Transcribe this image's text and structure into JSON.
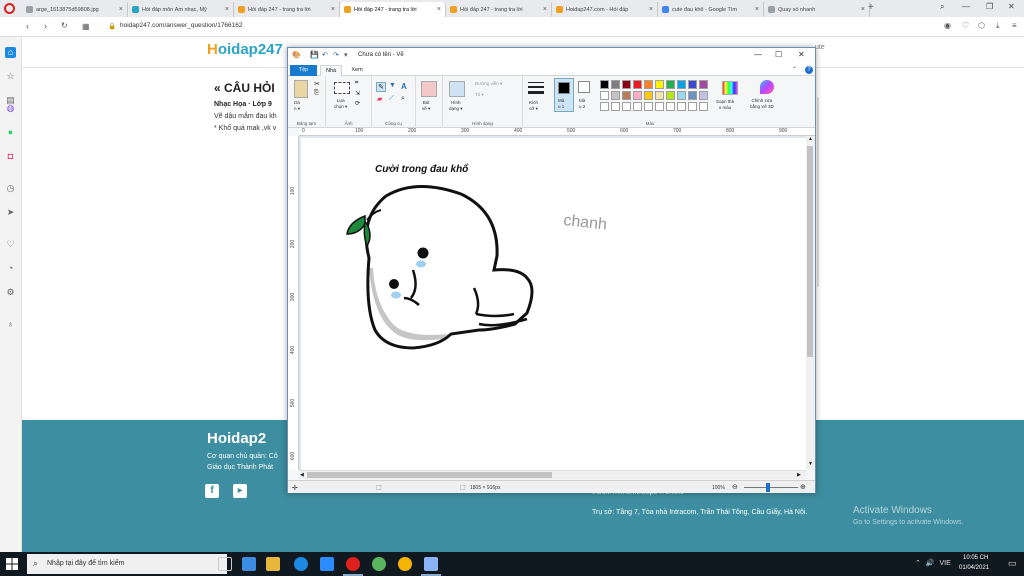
{
  "browser": {
    "tabs": [
      {
        "label": "arge_1613875d59808.jpg",
        "color": "#9aa0a6"
      },
      {
        "label": "Hỏi đáp môn Âm nhạc, Mỹ",
        "color": "#2aa5c7"
      },
      {
        "label": "Hỏi đáp 247 - trang tra lời",
        "color": "#f0a020"
      },
      {
        "label": "Hỏi đáp 247 - trang tra lời",
        "color": "#f0a020"
      },
      {
        "label": "Hỏi đáp 247 - trang tra lời",
        "color": "#f0a020"
      },
      {
        "label": "Hoidap247.com - Hỏi đáp",
        "color": "#f0a020"
      },
      {
        "label": "cute đau khổ - Google Tìm",
        "color": "#4285f4"
      },
      {
        "label": "Quay số nhanh",
        "color": "#9aa0a6"
      }
    ],
    "active_tab": 3,
    "url": "hoidap247.com/answer_question/1766162",
    "new_tab": "+"
  },
  "site": {
    "logo": "Hoidap247",
    "heading": "« CÂU HỎI",
    "subject": "Nhạc Họa · Lớp 9",
    "question_line1": "Vẽ dậu mắm đau kh",
    "question_line2": "* Khổ quá mak ,vk v",
    "right_note": "ute",
    "footer": {
      "logo": "Hoidap2",
      "org_line1": "Cơ quan chủ quản: Cô",
      "org_line2": "Giáo dục Thành Phát",
      "inbox": "Inbox: m.me/hoidap247online",
      "address": "Trụ sở: Tầng 7, Tòa nhà Intracom, Trần Thái Tông, Cầu Giấy, Hà Nội."
    },
    "activate_title": "Activate Windows",
    "activate_sub": "Go to Settings to activate Windows."
  },
  "paint": {
    "title": "Chưa có tên - Vẽ",
    "tabs": {
      "file": "Tệp",
      "home": "Nhà",
      "view": "Xem"
    },
    "groups": {
      "clipboard": "Bảng tạm",
      "image": "Ảnh",
      "tools": "Công cụ",
      "shapes": "Hình dạng",
      "colors": "Màu"
    },
    "buttons": {
      "paste": "Dá\nn ▾",
      "select": "Lựa\nchọn ▾",
      "brushes": "Bút\nvẽ ▾",
      "shapes": "Hình\ndạng ▾",
      "outline": "Đường viền ▾",
      "fill": "Tô ▾",
      "size": "Kích\ncỡ ▾",
      "color1": "Mà\nu 1",
      "color2": "Mà\nu 2",
      "edit_colors": "Soạn thả\no màu",
      "paint3d": "Chỉnh sửa\nbằng Vẽ 3D"
    },
    "ruler_marks": [
      "0",
      "100",
      "200",
      "300",
      "400",
      "500",
      "600",
      "700",
      "800",
      "900"
    ],
    "ruler_left_marks": [
      "100",
      "200",
      "300",
      "400",
      "500",
      "600"
    ],
    "drawing": {
      "title": "Cười trong đau khổ",
      "signature": "chanh"
    },
    "status": {
      "dimensions": "1805 × 916px",
      "zoom": "100%"
    },
    "palette": [
      "#000000",
      "#7f7f7f",
      "#880015",
      "#ed1c24",
      "#ff7f27",
      "#fff200",
      "#22b14c",
      "#00a2e8",
      "#3f48cc",
      "#a349a4",
      "#ffffff",
      "#c3c3c3",
      "#b97a57",
      "#ffaec9",
      "#ffc90e",
      "#efe4b0",
      "#b5e61d",
      "#99d9ea",
      "#7092be",
      "#c8bfe7"
    ]
  },
  "taskbar": {
    "search_placeholder": "Nhập tại đây để tìm kiếm",
    "lang": "VIE",
    "time": "10:05 CH",
    "date": "01/04/2021"
  }
}
